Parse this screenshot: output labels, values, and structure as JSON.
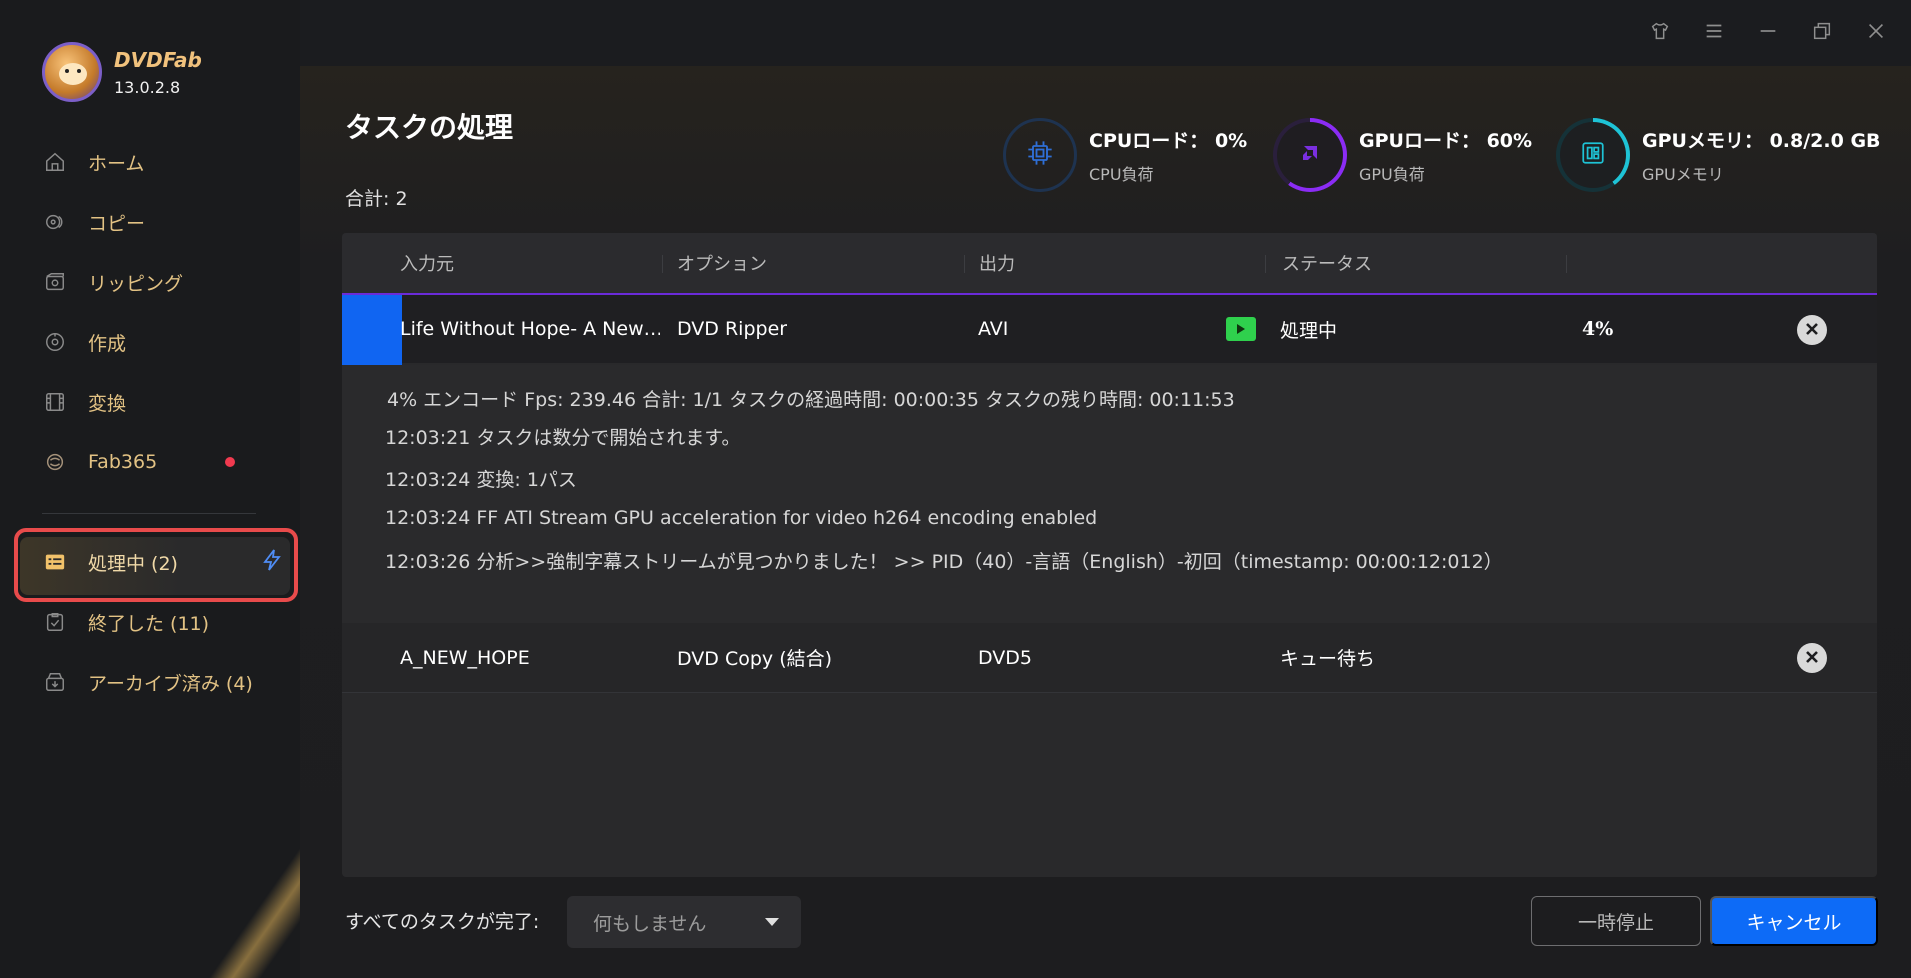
{
  "app": {
    "name": "DVDFab",
    "version": "13.0.2.8"
  },
  "sidebar": {
    "items": [
      {
        "label": "ホーム",
        "icon": "home-icon"
      },
      {
        "label": "コピー",
        "icon": "copy-icon"
      },
      {
        "label": "リッピング",
        "icon": "ripping-icon"
      },
      {
        "label": "作成",
        "icon": "create-icon"
      },
      {
        "label": "変換",
        "icon": "convert-icon"
      },
      {
        "label": "Fab365",
        "icon": "fab365-icon",
        "badge": true
      }
    ],
    "task_items": [
      {
        "label": "処理中 (2)",
        "icon": "task-list-icon",
        "active": true
      },
      {
        "label": "終了した (11)",
        "icon": "finished-icon"
      },
      {
        "label": "アーカイブ済み (4)",
        "icon": "archive-icon"
      }
    ]
  },
  "header": {
    "title": "タスクの処理",
    "total": "合計: 2"
  },
  "stats": {
    "cpu": {
      "label": "CPUロード：",
      "value": "0%",
      "sub": "CPU負荷",
      "percent": 0
    },
    "gpu": {
      "label": "GPUロード：",
      "value": "60%",
      "sub": "GPU負荷",
      "percent": 60
    },
    "gpu_mem": {
      "label": "GPUメモリ：",
      "value": "0.8/2.0 GB",
      "sub": "GPUメモリ",
      "percent": 40
    }
  },
  "table": {
    "columns": [
      "入力元",
      "オプション",
      "出力",
      "ステータス"
    ],
    "rows": [
      {
        "source": "Life Without Hope- A New…",
        "option": "DVD Ripper",
        "output": "AVI",
        "status": "処理中",
        "progress": "4%"
      },
      {
        "source": "A_NEW_HOPE",
        "option": "DVD Copy (結合)",
        "output": "DVD5",
        "status": "キュー待ち"
      }
    ],
    "detail": {
      "summary": "4%  エンコード Fps: 239.46   合計: 1/1   タスクの経過時間: 00:00:35   タスクの残り時間: 00:11:53",
      "logs": [
        "12:03:21  タスクは数分で開始されます。",
        "12:03:24  変換: 1パス",
        "12:03:24  FF ATI Stream GPU acceleration for video h264 encoding enabled",
        "12:03:26  分析>>強制字幕ストリームが見つかりました！ >> PID（40）-言語（English）-初回（timestamp: 00:00:12:012）"
      ]
    }
  },
  "footer": {
    "label": "すべてのタスクが完了:",
    "select_value": "何もしません",
    "pause_label": "一時停止",
    "cancel_label": "キャンセル"
  },
  "colors": {
    "accent": "#0d6bf7",
    "gold": "#e2c284",
    "gpu_ring": "#8b2cf5",
    "mem_ring": "#1ec3d6",
    "playing": "#2fd04d",
    "alert": "#e84b4b"
  }
}
